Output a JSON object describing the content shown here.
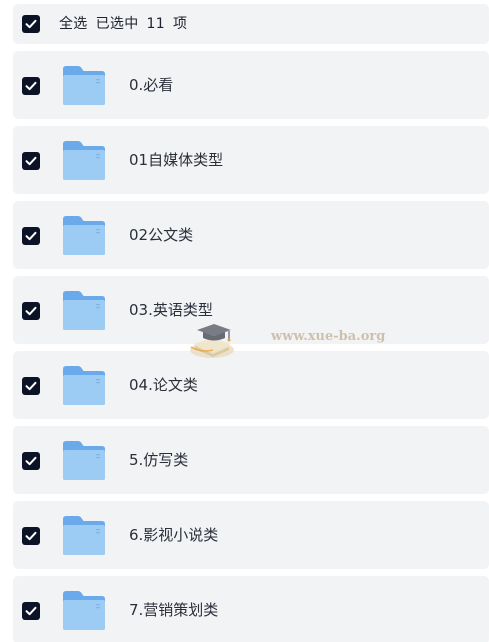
{
  "selection": {
    "select_all_label": "全选",
    "selected_prefix": "已选中",
    "selected_count": "11",
    "selected_suffix": "项",
    "all_checked": true
  },
  "folders": [
    {
      "name": "0.必看",
      "checked": true
    },
    {
      "name": "01自媒体类型",
      "checked": true
    },
    {
      "name": "02公文类",
      "checked": true
    },
    {
      "name": "03.英语类型",
      "checked": true
    },
    {
      "name": "04.论文类",
      "checked": true
    },
    {
      "name": "5.仿写类",
      "checked": true
    },
    {
      "name": "6.影视小说类",
      "checked": true
    },
    {
      "name": "7.营销策划类",
      "checked": true
    }
  ],
  "watermark": {
    "text": "www.xue-ba.org"
  },
  "colors": {
    "checkbox": "#0d1326",
    "row_background": "#f2f3f5",
    "folder_back": "#6aa9ea",
    "folder_front": "#9ccbf4"
  },
  "icons": {
    "checkbox": "checkbox-checked-icon",
    "folder": "folder-icon",
    "watermark_logo": "graduation-cap-books-logo"
  }
}
